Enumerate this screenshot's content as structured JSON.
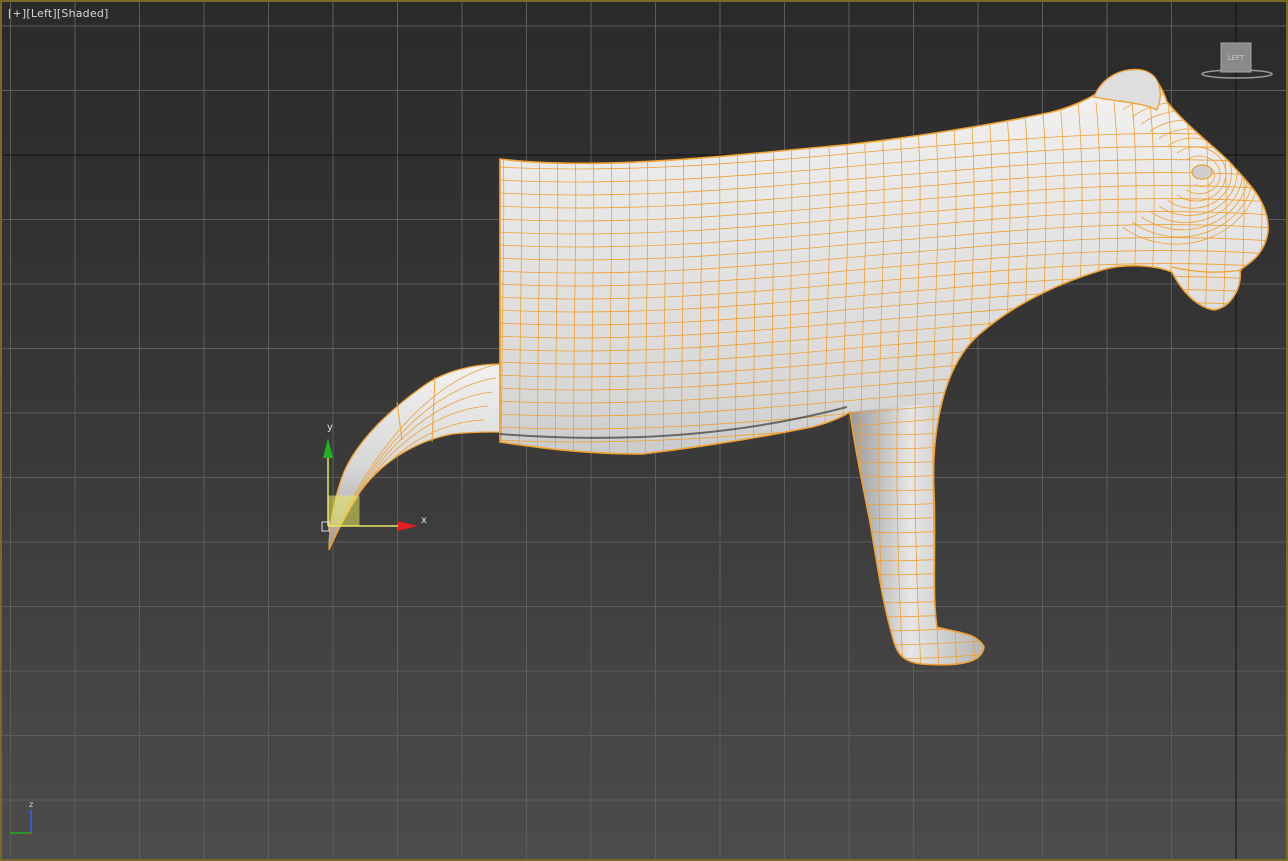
{
  "viewport": {
    "label_plus": "[+]",
    "label_view": "[Left]",
    "label_mode": "[Shaded]",
    "viewcube_face": "LEFT",
    "gizmo_x": "x",
    "gizmo_y": "y",
    "axis_tripod_z": "z"
  },
  "colors": {
    "background_top": "#2a2a2a",
    "background_bottom": "#4c4c4c",
    "grid": "#5a5a5a",
    "grid_major": "#111111",
    "wire_selected": "#f0a030",
    "mesh_fill": "#c9c9c9",
    "gizmo_x": "#e02020",
    "gizmo_y": "#20b020",
    "gizmo_plane": "#e8e860"
  }
}
